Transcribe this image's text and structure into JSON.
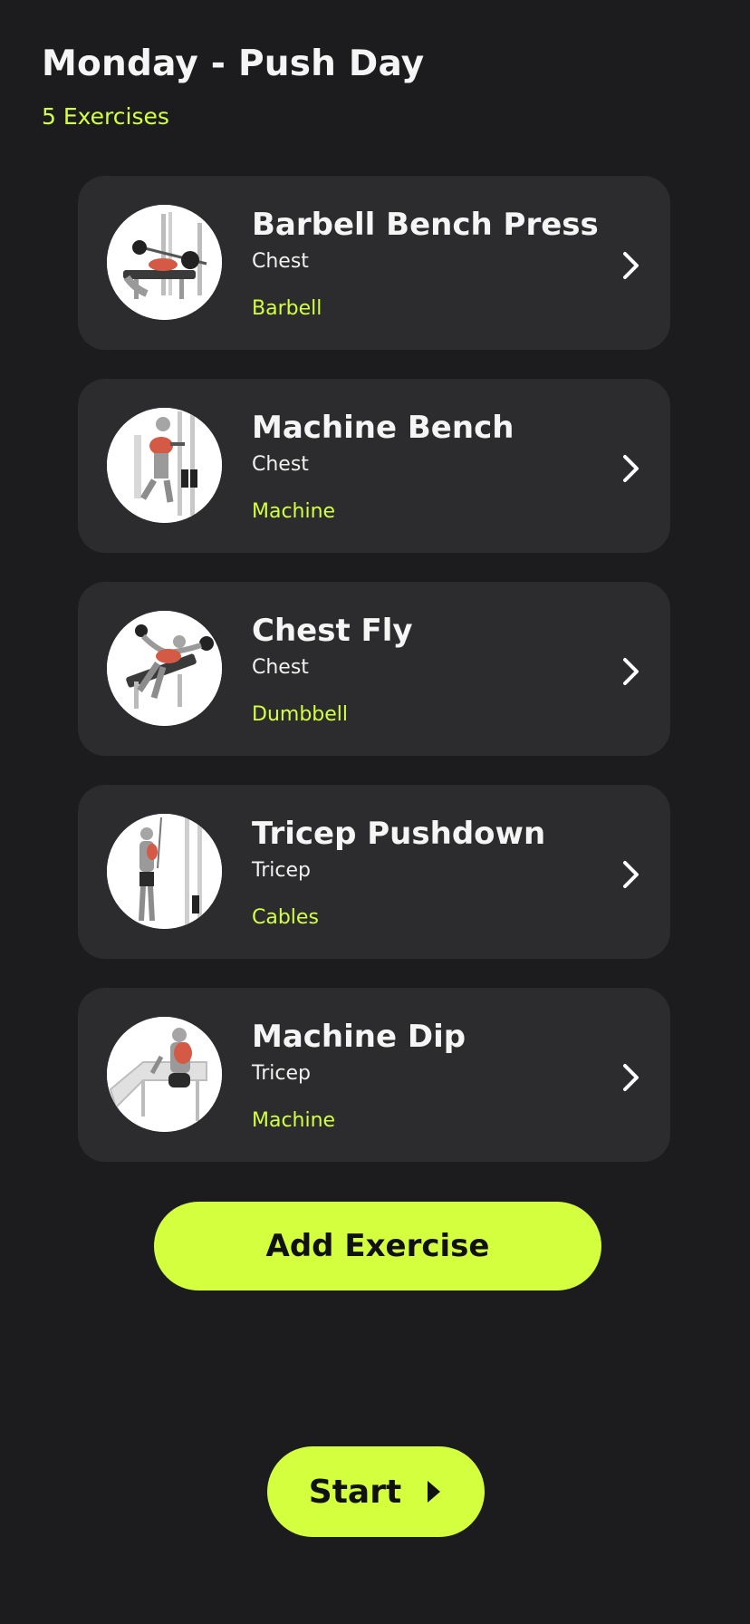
{
  "header": {
    "title": "Monday - Push Day",
    "subtitle": "5 Exercises"
  },
  "exercises": [
    {
      "name": "Barbell Bench Press",
      "muscle": "Chest",
      "equipment": "Barbell",
      "icon": "bench-press-illustration"
    },
    {
      "name": "Machine Bench",
      "muscle": "Chest",
      "equipment": "Machine",
      "icon": "machine-bench-illustration"
    },
    {
      "name": "Chest Fly",
      "muscle": "Chest",
      "equipment": "Dumbbell",
      "icon": "chest-fly-illustration"
    },
    {
      "name": "Tricep Pushdown",
      "muscle": "Tricep",
      "equipment": "Cables",
      "icon": "tricep-pushdown-illustration"
    },
    {
      "name": "Machine Dip",
      "muscle": "Tricep",
      "equipment": "Machine",
      "icon": "machine-dip-illustration"
    }
  ],
  "actions": {
    "add_label": "Add Exercise",
    "start_label": "Start"
  },
  "colors": {
    "background": "#1c1c1e",
    "card": "#2c2c2e",
    "accent": "#d4ff3f",
    "text": "#f5f5f5"
  }
}
